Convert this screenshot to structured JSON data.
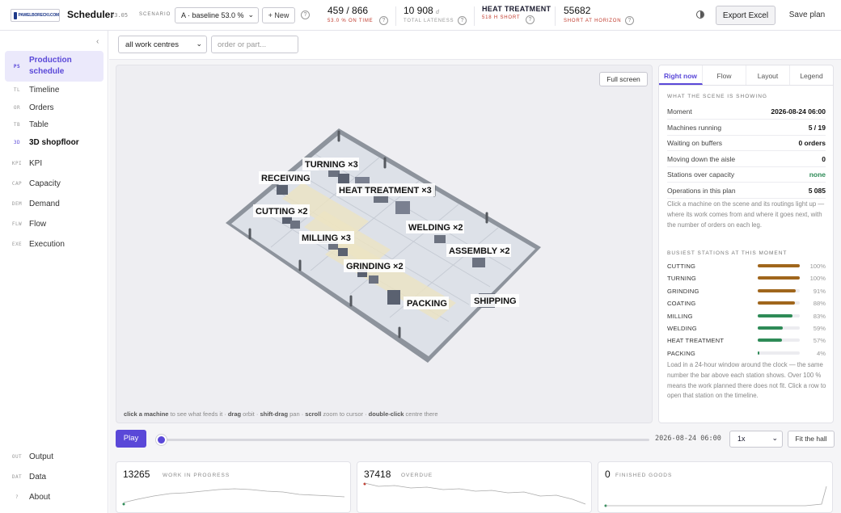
{
  "header": {
    "logo_text": "PAWELBORECKI.COM",
    "app_name": "Scheduler",
    "app_version": "v3.05",
    "scenario_label": "SCENARIO",
    "scenario_value": "A · baseline 53.0 %",
    "new_label": "+ New",
    "help_glyph": "?",
    "kpis": {
      "on_time": {
        "value": "459 / 866",
        "sub": "53.0 % ON TIME"
      },
      "lateness": {
        "value": "10 908",
        "unit": "d",
        "sub": "TOTAL LATENESS"
      },
      "heat": {
        "title": "HEAT TREATMENT",
        "sub": "518 H SHORT"
      },
      "short": {
        "value": "55682",
        "sub": "SHORT AT HORIZON"
      }
    },
    "export_label": "Export Excel",
    "save_label": "Save plan"
  },
  "sidebar": {
    "collapse_glyph": "‹",
    "items": [
      {
        "abbr": "PS",
        "label": "Production schedule"
      },
      {
        "abbr": "TL",
        "label": "Timeline"
      },
      {
        "abbr": "OR",
        "label": "Orders"
      },
      {
        "abbr": "TB",
        "label": "Table"
      },
      {
        "abbr": "3D",
        "label": "3D shopfloor"
      },
      {
        "abbr": "KPI",
        "label": "KPI"
      },
      {
        "abbr": "CAP",
        "label": "Capacity"
      },
      {
        "abbr": "DEM",
        "label": "Demand"
      },
      {
        "abbr": "FLW",
        "label": "Flow"
      },
      {
        "abbr": "EXE",
        "label": "Execution"
      }
    ],
    "bottom": [
      {
        "abbr": "OUT",
        "label": "Output"
      },
      {
        "abbr": "DAT",
        "label": "Data"
      },
      {
        "abbr": "?",
        "label": "About"
      }
    ]
  },
  "filters": {
    "work_centre": "all work centres",
    "order_placeholder": "order or part..."
  },
  "scene": {
    "fullscreen_label": "Full screen",
    "hint": {
      "k1": "click a machine",
      "t1": " to see what feeds it · ",
      "k2": "drag",
      "t2": " orbit · ",
      "k3": "shift-drag",
      "t3": " pan · ",
      "k4": "scroll",
      "t4": " zoom to cursor · ",
      "k5": "double-click",
      "t5": " centre there"
    },
    "stations": {
      "receiving": "RECEIVING",
      "turning": "TURNING ×3",
      "heat": "HEAT TREATMENT ×3",
      "cutting": "CUTTING ×2",
      "milling": "MILLING ×3",
      "welding": "WELDING ×2",
      "assembly": "ASSEMBLY ×2",
      "grinding": "GRINDING ×2",
      "packing": "PACKING",
      "shipping": "SHIPPING"
    }
  },
  "panel": {
    "tabs": [
      "Right now",
      "Flow",
      "Layout",
      "Legend"
    ],
    "section1": "WHAT THE SCENE IS SHOWING",
    "rows": [
      {
        "label": "Moment",
        "value": "2026-08-24 06:00"
      },
      {
        "label": "Machines running",
        "value": "5 / 19"
      },
      {
        "label": "Waiting on buffers",
        "value": "0 orders"
      },
      {
        "label": "Moving down the aisle",
        "value": "0"
      },
      {
        "label": "Stations over capacity",
        "value": "none"
      },
      {
        "label": "Operations in this plan",
        "value": "5 085"
      }
    ],
    "note1": "Click a machine on the scene and its routings light up — where its work comes from and where it goes next, with the number of orders on each leg.",
    "section2": "BUSIEST STATIONS AT THIS MOMENT",
    "busiest": [
      {
        "name": "CUTTING",
        "pct": 100,
        "label": "100%",
        "color": "#a0661c"
      },
      {
        "name": "TURNING",
        "pct": 100,
        "label": "100%",
        "color": "#a0661c"
      },
      {
        "name": "GRINDING",
        "pct": 91,
        "label": "91%",
        "color": "#a0661c"
      },
      {
        "name": "COATING",
        "pct": 88,
        "label": "88%",
        "color": "#a0661c"
      },
      {
        "name": "MILLING",
        "pct": 83,
        "label": "83%",
        "color": "#2e8b57"
      },
      {
        "name": "WELDING",
        "pct": 59,
        "label": "59%",
        "color": "#2e8b57"
      },
      {
        "name": "HEAT TREATMENT",
        "pct": 57,
        "label": "57%",
        "color": "#2e8b57"
      },
      {
        "name": "PACKING",
        "pct": 4,
        "label": "4%",
        "color": "#2e8b57"
      }
    ],
    "note2": "Load in a 24-hour window around the clock — the same number the bar above each station shows. Over 100 % means the work planned there does not fit. Click a row to open that station on the timeline."
  },
  "playback": {
    "play_label": "Play",
    "position": 0,
    "time": "2026-08-24 06:00",
    "speed": "1x",
    "fit_label": "Fit the hall"
  },
  "cards": [
    {
      "value": "13265",
      "label": "WORK IN PROGRESS"
    },
    {
      "value": "37418",
      "label": "OVERDUE"
    },
    {
      "value": "0",
      "label": "FINISHED GOODS"
    }
  ]
}
